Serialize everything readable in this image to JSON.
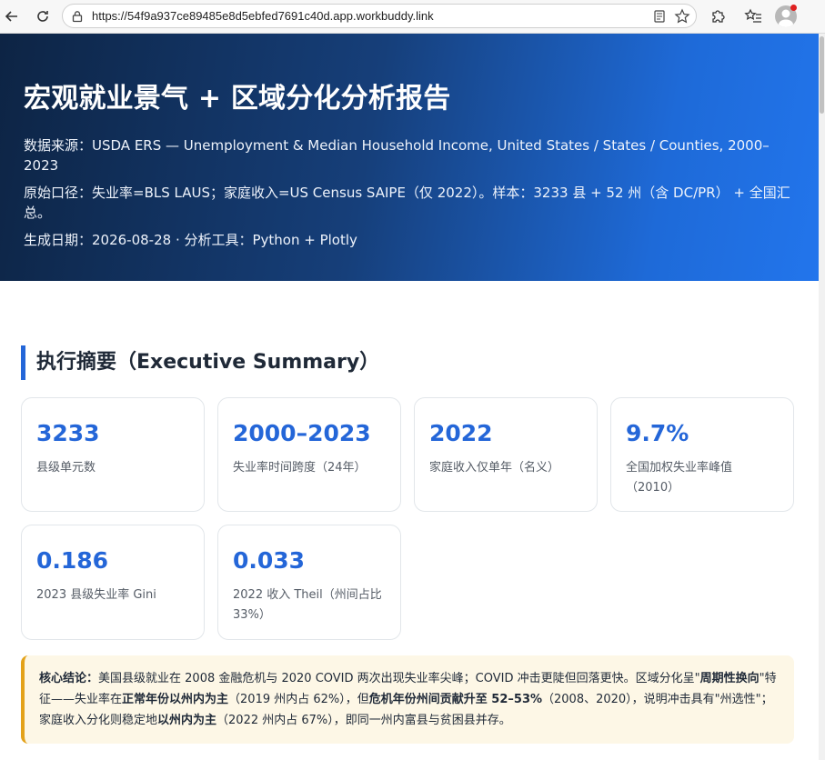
{
  "browser": {
    "url": "https://54f9a937ce89485e8d5ebfed7691c40d.app.workbuddy.link"
  },
  "hero": {
    "title": "宏观就业景气 + 区域分化分析报告",
    "source_line": "数据来源：USDA ERS — Unemployment & Median Household Income, United States / States / Counties, 2000–2023",
    "scope_line": "原始口径：失业率=BLS LAUS；家庭收入=US Census SAIPE（仅 2022）。样本：3233 县 + 52 州（含 DC/PR） + 全国汇总。",
    "date_line": "生成日期：2026-08-28 · 分析工具：Python + Plotly"
  },
  "summary": {
    "title": "执行摘要（Executive Summary）",
    "cards": [
      {
        "value": "3233",
        "label": "县级单元数"
      },
      {
        "value": "2000–2023",
        "label": "失业率时间跨度（24年）"
      },
      {
        "value": "2022",
        "label": "家庭收入仅单年（名义）"
      },
      {
        "value": "9.7%",
        "label": "全国加权失业率峰值（2010）"
      },
      {
        "value": "0.186",
        "label": "2023 县级失业率 Gini"
      },
      {
        "value": "0.033",
        "label": "2022 收入 Theil（州间占比 33%）"
      }
    ]
  },
  "conclusion": {
    "t1": "核心结论：",
    "t2": "美国县级就业在 2008 金融危机与 2020 COVID 两次出现失业率尖峰；COVID 冲击更陡但回落更快。区域分化呈\"",
    "t3": "周期性换向",
    "t4": "\"特征——失业率在",
    "t5": "正常年份以州内为主",
    "t6": "（2019 州内占 62%），但",
    "t7": "危机年份州间贡献升至 52–53%",
    "t8": "（2008、2020），说明冲击具有\"州选性\"；家庭收入分化则稳定地",
    "t9": "以州内为主",
    "t10": "（2022 州内占 67%），即同一州内富县与贫困县并存。"
  }
}
